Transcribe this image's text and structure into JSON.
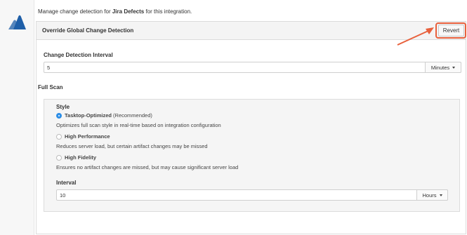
{
  "intro": {
    "prefix": "Manage change detection for ",
    "connector": "Jira Defects",
    "suffix": " for this integration."
  },
  "panel": {
    "title": "Override Global Change Detection",
    "revert_label": "Revert"
  },
  "change_interval": {
    "label": "Change Detection Interval",
    "value": "5",
    "unit": "Minutes"
  },
  "full_scan": {
    "label": "Full Scan",
    "style_label": "Style",
    "options": [
      {
        "name": "Tasktop-Optimized",
        "tag": " (Recommended)",
        "desc": "Optimizes full scan style in real-time based on integration configuration",
        "selected": true
      },
      {
        "name": "High Performance",
        "tag": "",
        "desc": "Reduces server load, but certain artifact changes may be missed",
        "selected": false
      },
      {
        "name": "High Fidelity",
        "tag": "",
        "desc": "Ensures no artifact changes are missed, but may cause significant server load",
        "selected": false
      }
    ],
    "interval_label": "Interval",
    "interval_value": "10",
    "interval_unit": "Hours"
  },
  "colors": {
    "accent_blue": "#2d8ee6",
    "highlight": "#e8603c",
    "logo": "#1f5fa8"
  },
  "icons": [
    "atlassian-logo-icon",
    "annotation-arrow-icon",
    "chevron-down-icon"
  ]
}
